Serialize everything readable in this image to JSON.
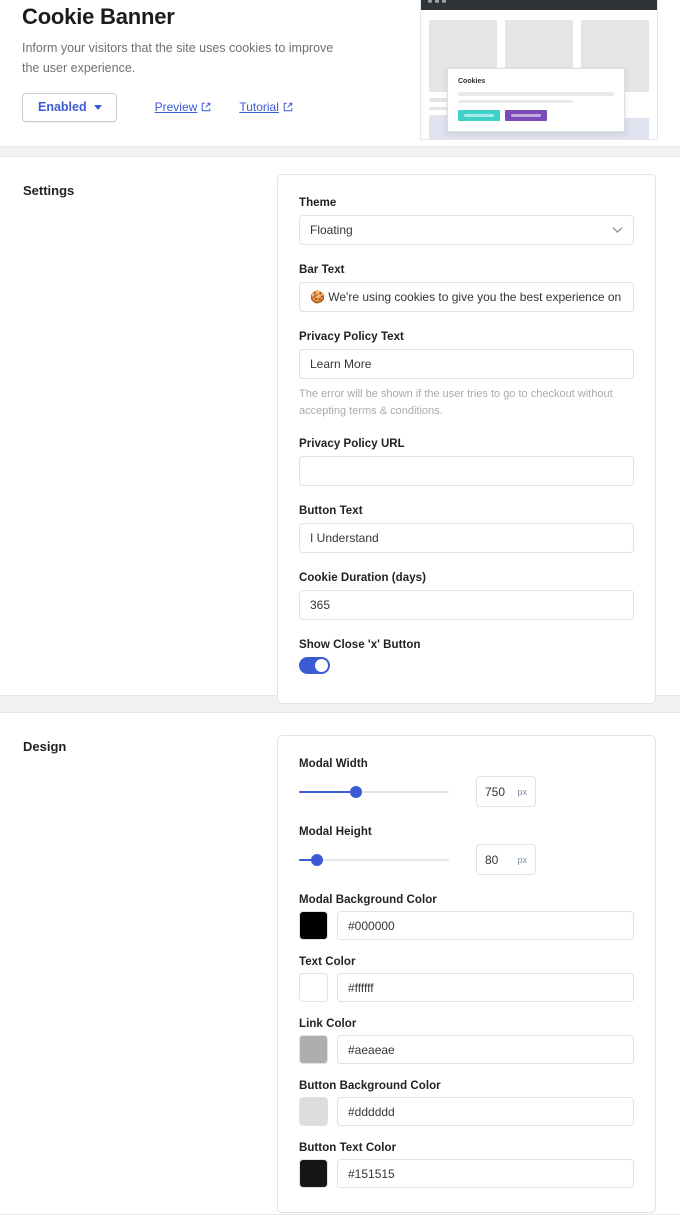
{
  "header": {
    "title": "Cookie Banner",
    "subtitle": "Inform your visitors that the site uses cookies to improve the user experience.",
    "status_button": "Enabled",
    "preview_link": "Preview",
    "tutorial_link": "Tutorial"
  },
  "preview": {
    "modal_title": "Cookies",
    "accept_color": "#3fd0c9",
    "decline_color": "#7b4bb7",
    "topbar_color": "#2f3337"
  },
  "settings": {
    "section_title": "Settings",
    "theme": {
      "label": "Theme",
      "value": "Floating"
    },
    "bar_text": {
      "label": "Bar Text",
      "value": "🍪 We're using cookies to give you the best experience on our site."
    },
    "privacy_policy_text": {
      "label": "Privacy Policy Text",
      "value": "Learn More",
      "helper": "The error will be shown if the user tries to go to checkout without accepting terms & conditions."
    },
    "privacy_policy_url": {
      "label": "Privacy Policy URL",
      "value": "",
      "placeholder": ""
    },
    "button_text": {
      "label": "Button Text",
      "value": "I Understand"
    },
    "cookie_duration": {
      "label": "Cookie Duration (days)",
      "value": "365"
    },
    "show_close_button": {
      "label": "Show Close 'x' Button",
      "enabled": true
    }
  },
  "design": {
    "section_title": "Design",
    "modal_width": {
      "label": "Modal Width",
      "value": "750",
      "unit": "px",
      "percent": 38
    },
    "modal_height": {
      "label": "Modal Height",
      "value": "80",
      "unit": "px",
      "percent": 12
    },
    "colors": [
      {
        "label": "Modal Background Color",
        "value": "#000000"
      },
      {
        "label": "Text Color",
        "value": "#ffffff"
      },
      {
        "label": "Link Color",
        "value": "#aeaeae"
      },
      {
        "label": "Button Background Color",
        "value": "#dddddd"
      },
      {
        "label": "Button Text Color",
        "value": "#151515"
      }
    ]
  },
  "theme": {
    "accent": "#3b5bd4",
    "link": "#3b5bd4"
  }
}
